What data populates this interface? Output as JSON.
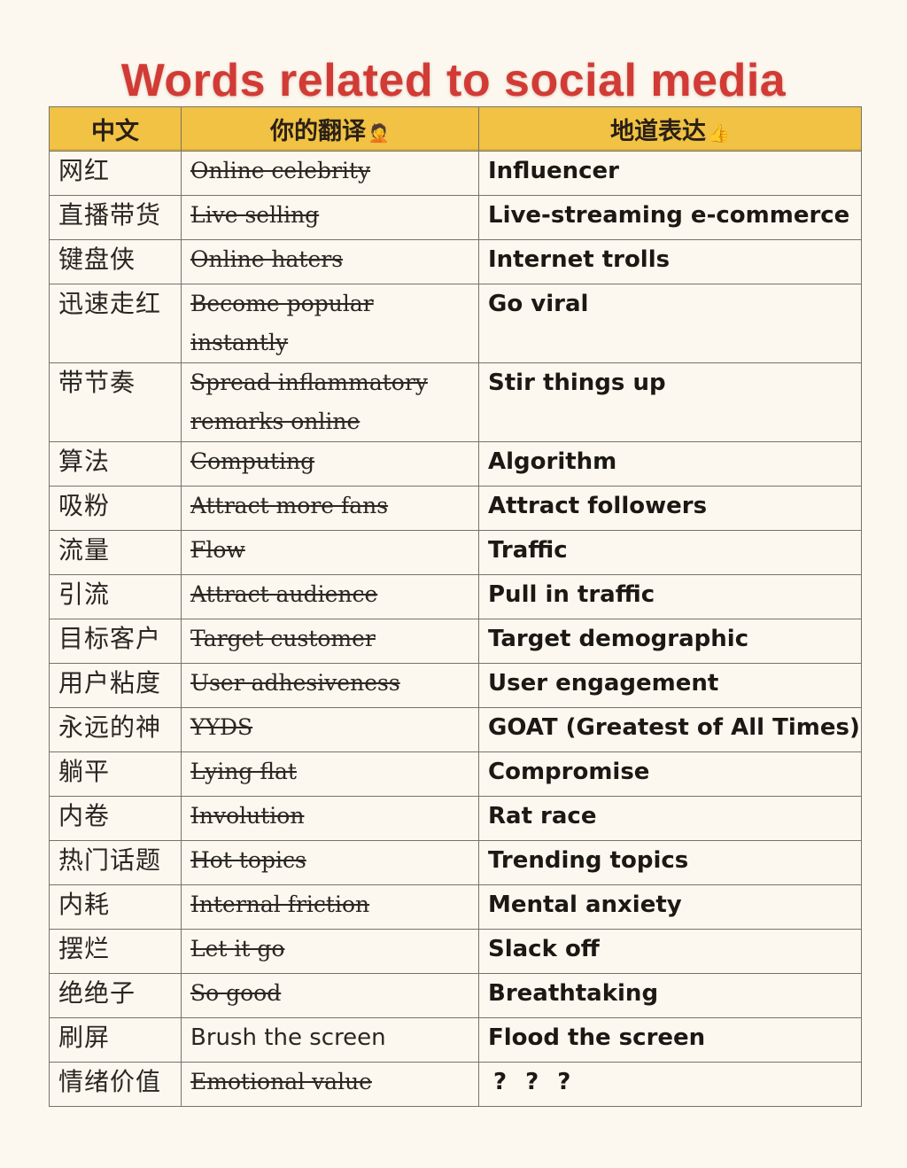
{
  "title": "Words related to social media",
  "colors": {
    "title": "#d23b35",
    "header_background": "#f1c243",
    "page_background": "#fcf8ef",
    "border": "#77726a"
  },
  "table": {
    "headers": [
      {
        "label": "中文",
        "icon": null
      },
      {
        "label": "你的翻译",
        "icon": "person-facepalm-icon",
        "icon_glyph": "🤦"
      },
      {
        "label": "地道表达",
        "icon": "thumbs-up-icon",
        "icon_glyph": "👍"
      }
    ],
    "rows": [
      {
        "chinese": "网红",
        "your_translation": "Online celebrity",
        "struck": true,
        "idiomatic": "Influencer"
      },
      {
        "chinese": "直播带货",
        "your_translation": "Live selling",
        "struck": true,
        "idiomatic": "Live-streaming e-commerce"
      },
      {
        "chinese": "键盘侠",
        "your_translation": "Online haters",
        "struck": true,
        "idiomatic": "Internet trolls"
      },
      {
        "chinese": "迅速走红",
        "your_translation": "Become popular instantly",
        "struck": true,
        "idiomatic": "Go viral"
      },
      {
        "chinese": "带节奏",
        "your_translation": "Spread inflammatory remarks online",
        "struck": true,
        "idiomatic": "Stir things up"
      },
      {
        "chinese": "算法",
        "your_translation": "Computing",
        "struck": true,
        "idiomatic": "Algorithm"
      },
      {
        "chinese": "吸粉",
        "your_translation": "Attract more fans",
        "struck": true,
        "idiomatic": "Attract followers"
      },
      {
        "chinese": "流量",
        "your_translation": "Flow",
        "struck": true,
        "idiomatic": "Traffic"
      },
      {
        "chinese": "引流",
        "your_translation": "Attract audience",
        "struck": true,
        "idiomatic": "Pull in traffic"
      },
      {
        "chinese": "目标客户",
        "your_translation": "Target customer",
        "struck": true,
        "idiomatic": "Target demographic"
      },
      {
        "chinese": "用户粘度",
        "your_translation": "User adhesiveness",
        "struck": true,
        "idiomatic": "User engagement"
      },
      {
        "chinese": "永远的神",
        "your_translation": "YYDS",
        "struck": true,
        "idiomatic": "GOAT (Greatest of All Times)"
      },
      {
        "chinese": "躺平",
        "your_translation": "Lying flat",
        "struck": true,
        "idiomatic": "Compromise"
      },
      {
        "chinese": "内卷",
        "your_translation": "Involution",
        "struck": true,
        "idiomatic": "Rat race"
      },
      {
        "chinese": "热门话题",
        "your_translation": "Hot topics",
        "struck": true,
        "idiomatic": "Trending topics"
      },
      {
        "chinese": "内耗",
        "your_translation": "Internal friction",
        "struck": true,
        "idiomatic": "Mental anxiety"
      },
      {
        "chinese": "摆烂",
        "your_translation": "Let it go",
        "struck": true,
        "idiomatic": "Slack off"
      },
      {
        "chinese": "绝绝子",
        "your_translation": "So good",
        "struck": true,
        "idiomatic": "Breathtaking"
      },
      {
        "chinese": "刷屏",
        "your_translation": "Brush the screen",
        "struck": false,
        "idiomatic": "Flood the screen"
      },
      {
        "chinese": "情绪价值",
        "your_translation": "Emotional value",
        "struck": true,
        "idiomatic": "? ? ?"
      }
    ]
  }
}
